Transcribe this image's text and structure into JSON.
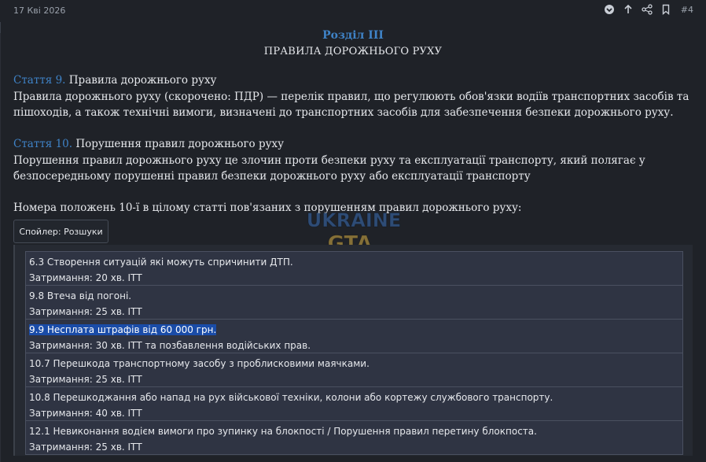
{
  "post": {
    "date": "17 Кві 2026",
    "number": "#4"
  },
  "icons": [
    "reaction-icon",
    "arrow-up-icon",
    "share-icon",
    "bookmark-icon"
  ],
  "section": {
    "title": "Розділ III",
    "subtitle": "ПРАВИЛА ДОРОЖНЬОГО РУХУ"
  },
  "articles": [
    {
      "label": "Стаття 9.",
      "title": "Правила дорожнього руху",
      "text": "Правила дорожнього руху (скорочено: ПДР) — перелік правил, що регулюють обов'язки водіїв транспортних засобів та пішоходів, а також технічні вимоги, визначені до транспортних засобів для забезпечення безпеки дорожнього руху."
    },
    {
      "label": "Стаття 10.",
      "title": "Порушення правил дорожнього руху",
      "text": "Порушення правил дорожнього руху це злочин проти безпеки руху та експлуатації транспорту, який полягає у безпосередньому порушенні правил безпеки дорожнього руху або експлуатації транспорту"
    }
  ],
  "related_text": "Номера положень 10-ї в цілому статті пов'язаних з порушенням правил дорожнього руху:",
  "watermark": {
    "line1": "UKRAINE",
    "line2": "GTA"
  },
  "spoiler": {
    "button_label": "Спойлер: Розшуки",
    "rows": [
      {
        "line1": "6.3 Створення ситуацій які можуть спричинити ДТП.",
        "line2": "Затримання: 20 хв. ІТТ",
        "highlighted": false
      },
      {
        "line1": "9.8 Втеча від погоні.",
        "line2": "Затримання: 25 хв. ІТТ",
        "highlighted": false
      },
      {
        "line1": "9.9 Несплата штрафів від 60 000 грн.",
        "line2": "Затримання: 30 хв. ІТТ та позбавлення водійських прав.",
        "highlighted": true
      },
      {
        "line1": "10.7 Перешкода транспортному засобу з проблисковими маячками.",
        "line2": "Затримання: 25 хв. ІТТ",
        "highlighted": false
      },
      {
        "line1": "10.8 Перешкоджання або напад на рух військової техніки, колони або кортежу службового транспорту.",
        "line2": "Затримання: 40 хв. ІТТ",
        "highlighted": false
      },
      {
        "line1": "12.1 Невиконання водієм вимоги про зупинку на блокпості / Порушення правил перетину блокпоста.",
        "line2": "Затримання: 25 хв. ІТТ",
        "highlighted": false
      }
    ]
  },
  "colors": {
    "background": "#1f2228",
    "accent": "#3f83c7",
    "highlight": "#1a4ca8",
    "list_bg": "#2f3443"
  }
}
